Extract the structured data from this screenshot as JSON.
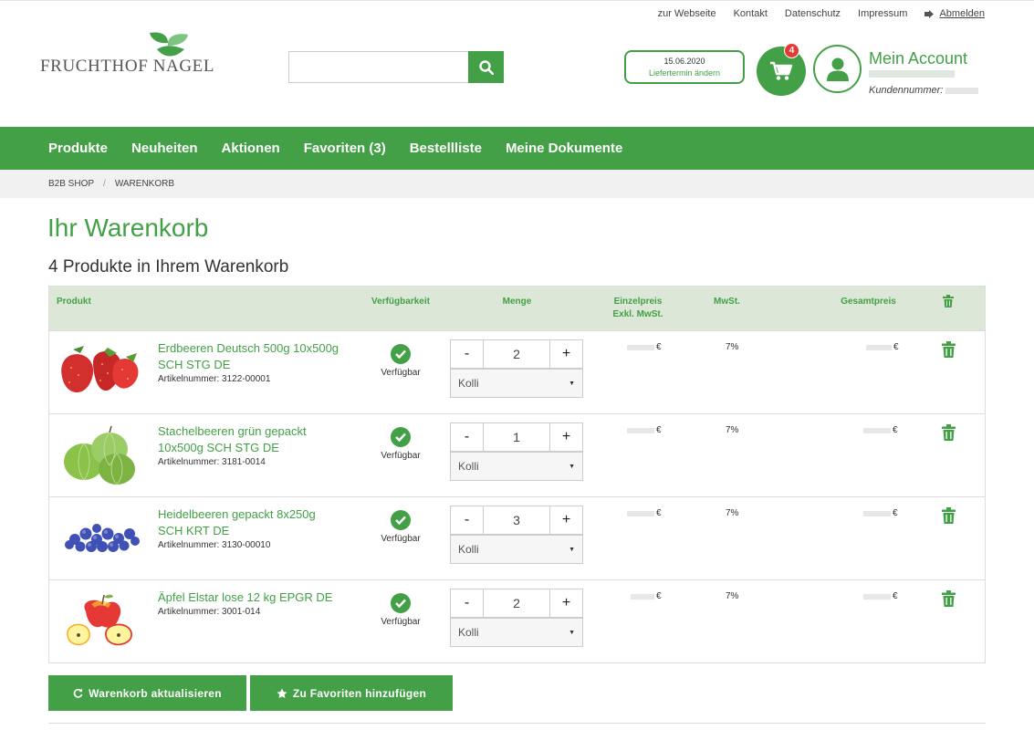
{
  "toplinks": {
    "website": "zur Webseite",
    "contact": "Kontakt",
    "privacy": "Datenschutz",
    "imprint": "Impressum",
    "logout": "Abmelden"
  },
  "logo": {
    "text": "FRUCHTHOF NAGEL"
  },
  "search": {
    "value": "",
    "placeholder": ""
  },
  "delivery": {
    "date": "15.06.2020",
    "change_label": "Liefertermin ändern"
  },
  "cart": {
    "count": "4"
  },
  "account": {
    "title": "Mein Account",
    "customer_label": "Kundennummer:"
  },
  "nav": [
    "Produkte",
    "Neuheiten",
    "Aktionen",
    "Favoriten (3)",
    "Bestellliste",
    "Meine Dokumente"
  ],
  "breadcrumb": {
    "home": "B2B SHOP",
    "separator": "/",
    "current": "WARENKORB"
  },
  "page": {
    "title": "Ihr Warenkorb",
    "count_text": "4 Produkte in Ihrem Warenkorb"
  },
  "table": {
    "headers": {
      "product": "Produkt",
      "availability": "Verfügbarkeit",
      "quantity": "Menge",
      "unit_price_1": "Einzelpreis",
      "unit_price_2": "Exkl. MwSt.",
      "vat": "MwSt.",
      "total": "Gesamtpreis"
    },
    "rows": [
      {
        "name": "Erdbeeren Deutsch 500g 10x500g SCH STG DE",
        "article": "Artikelnummer: 3122-00001",
        "availability": "Verfügbar",
        "qty": "2",
        "unit": "Kolli",
        "currency": "€",
        "vat": "7%",
        "image": "strawberries"
      },
      {
        "name": "Stachelbeeren grün gepackt 10x500g SCH STG DE",
        "article": "Artikelnummer: 3181-0014",
        "availability": "Verfügbar",
        "qty": "1",
        "unit": "Kolli",
        "currency": "€",
        "vat": "7%",
        "image": "gooseberries"
      },
      {
        "name": "Heidelbeeren gepackt 8x250g SCH KRT DE",
        "article": "Artikelnummer: 3130-00010",
        "availability": "Verfügbar",
        "qty": "3",
        "unit": "Kolli",
        "currency": "€",
        "vat": "7%",
        "image": "blueberries"
      },
      {
        "name": "Äpfel Elstar lose 12 kg EPGR DE",
        "article": "Artikelnummer: 3001-014",
        "availability": "Verfügbar",
        "qty": "2",
        "unit": "Kolli",
        "currency": "€",
        "vat": "7%",
        "image": "apples"
      }
    ],
    "minus": "-",
    "plus": "+"
  },
  "buttons": {
    "update": "Warenkorb aktualisieren",
    "favorites": "Zu Favoriten hinzufügen"
  },
  "colors": {
    "brand": "#43a047",
    "badge": "#e53935",
    "header_bg": "#dce7d8"
  },
  "icons": {
    "search": "search-icon",
    "cart": "shopping-cart-icon",
    "account": "user-icon",
    "logout": "sign-out-icon",
    "check": "check-circle-icon",
    "trash": "trash-icon",
    "refresh": "refresh-icon",
    "star": "star-icon"
  }
}
